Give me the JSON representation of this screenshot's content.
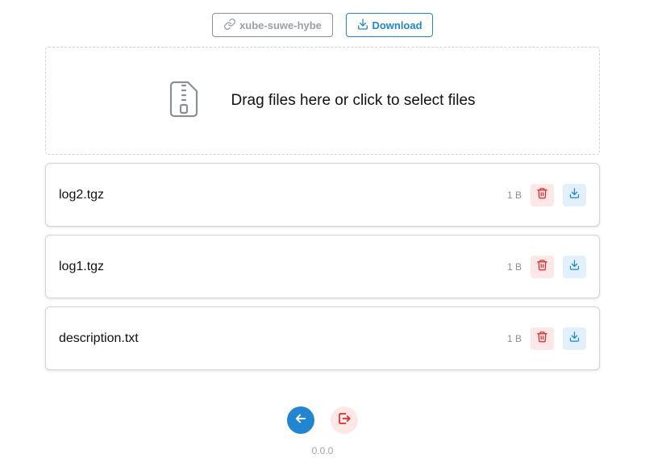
{
  "topbar": {
    "link_label": "xube-suwe-hybe",
    "download_label": "Download"
  },
  "dropzone": {
    "text": "Drag files here or click to select files"
  },
  "files": [
    {
      "name": "log2.tgz",
      "size": "1 B"
    },
    {
      "name": "log1.tgz",
      "size": "1 B"
    },
    {
      "name": "description.txt",
      "size": "1 B"
    }
  ],
  "footer": {
    "version": "0.0.0"
  },
  "colors": {
    "primary": "#2185d0",
    "danger": "#db2828",
    "danger_bg": "#fde7e7",
    "primary_bg": "#e2f0fb"
  },
  "icons": {
    "link": "link-icon",
    "download": "download-icon",
    "zip_file": "zip-file-icon",
    "delete": "trash-icon",
    "back": "arrow-left-icon",
    "logout": "logout-icon"
  }
}
